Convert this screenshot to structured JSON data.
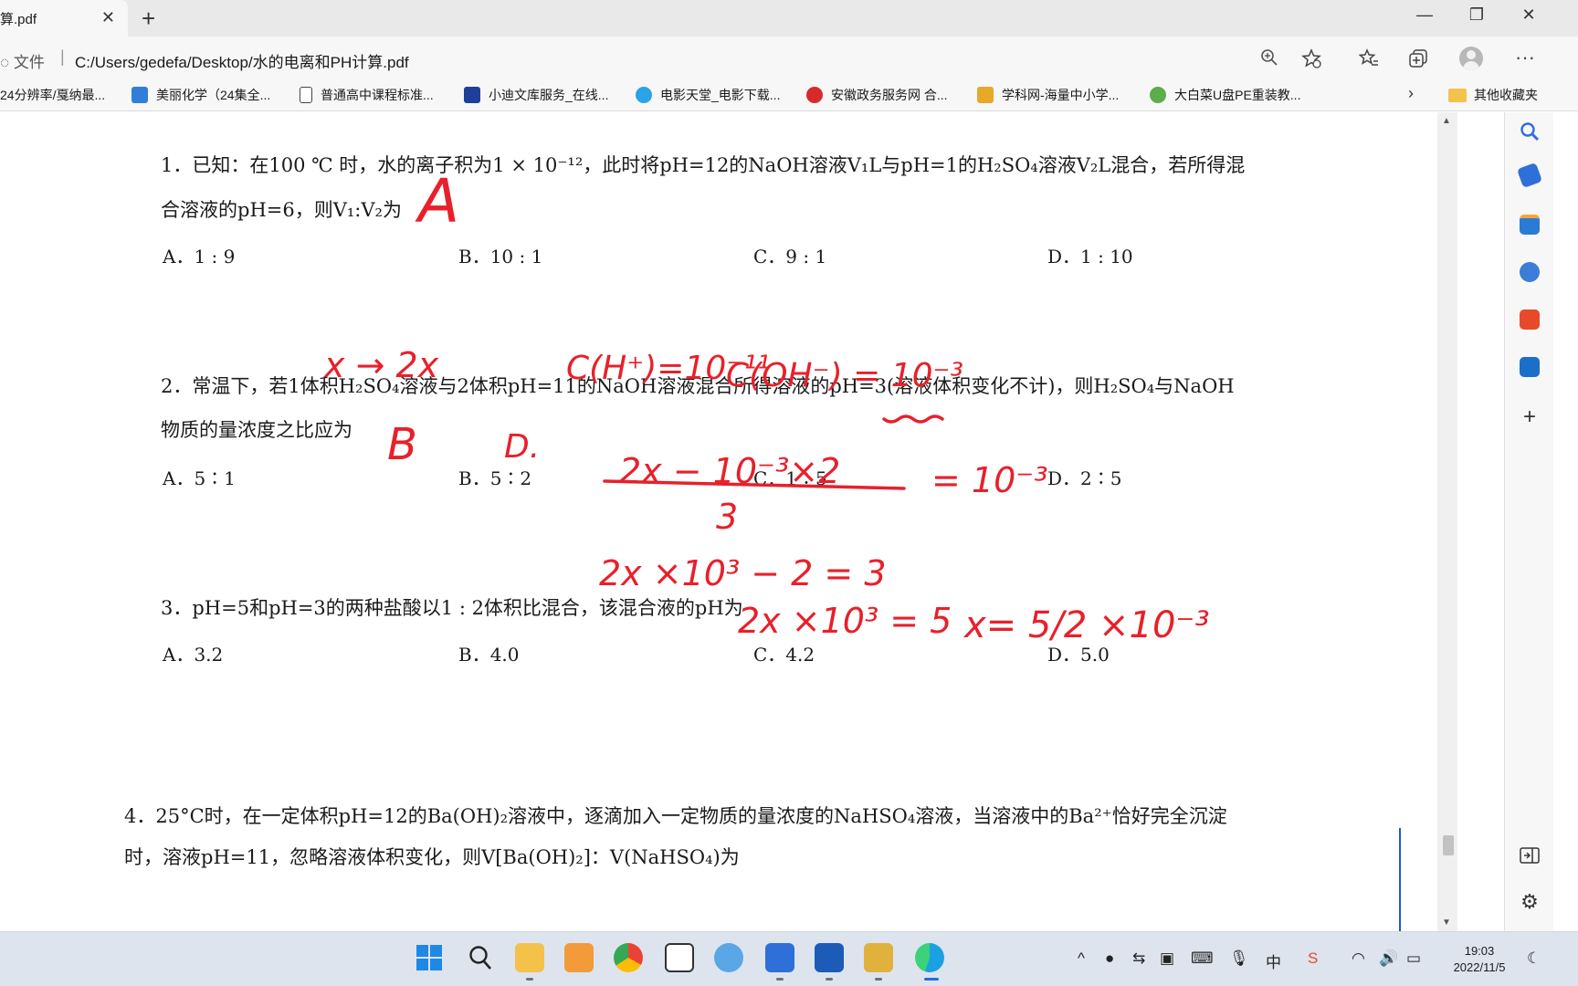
{
  "browser": {
    "tab_title": "算.pdf",
    "tab_close": "✕",
    "new_tab": "+",
    "window_controls": {
      "minimize": "—",
      "restore": "❐",
      "close": "✕"
    },
    "address_info_label": "文件",
    "address_url": "C:/Users/gedefa/Desktop/水的电离和PH计算.pdf",
    "toolbar_icons": [
      "zoom-icon",
      "add-favorite-icon",
      "favorites-icon",
      "collections-icon",
      "profile-avatar",
      "more-icon"
    ]
  },
  "favorites_bar": {
    "items": [
      {
        "label": "24分辨率/戛纳最...",
        "color": "#ffffff"
      },
      {
        "label": "美丽化学（24集全...",
        "color": "#2f7fd8"
      },
      {
        "label": "普通高中课程标准...",
        "color": "#ffffff"
      },
      {
        "label": "小迪文库服务_在线...",
        "color": "#1f3f9a"
      },
      {
        "label": "电影天堂_电影下载...",
        "color": "#2aa4e6"
      },
      {
        "label": "安徽政务服务网 合...",
        "color": "#d72b2b"
      },
      {
        "label": "学科网-海量中小学...",
        "color": "#e7a92a"
      },
      {
        "label": "大白菜U盘PE重装教...",
        "color": "#5cae4a"
      }
    ],
    "more": "›",
    "other_favorites": "其他收藏夹"
  },
  "document": {
    "q1": {
      "line1": "1．已知：在100 ℃ 时，水的离子积为1 × 10⁻¹²，此时将pH=12的NaOH溶液V₁L与pH=1的H₂SO₄溶液V₂L混合，若所得混",
      "line2": "合溶液的pH=6，则V₁:V₂为",
      "options": [
        "A．1 : 9",
        "B．10 : 1",
        "C．9 : 1",
        "D．1 : 10"
      ]
    },
    "q2": {
      "line1": "2．常温下，若1体积H₂SO₄溶液与2体积pH=11的NaOH溶液混合所得溶液的pH=3(溶液体积变化不计)，则H₂SO₄与NaOH",
      "line2": "物质的量浓度之比应为",
      "options": [
        "A．5∶1",
        "B．5∶2",
        "C．1∶5",
        "D．2∶5"
      ]
    },
    "q3": {
      "line1": "3．pH=5和pH=3的两种盐酸以1 : 2体积比混合，该混合液的pH为",
      "options": [
        "A．3.2",
        "B．4.0",
        "C．4.2",
        "D．5.0"
      ]
    },
    "q4": {
      "line1": "4．25°C时，在一定体积pH=12的Ba(OH)₂溶液中，逐滴加入一定物质的量浓度的NaHSO₄溶液，当溶液中的Ba²⁺恰好完全沉淀",
      "line2": "时，溶液pH=11，忽略溶液体积变化，则V[Ba(OH)₂]：V(NaHSO₄)为"
    },
    "annotations": {
      "q1_answer": "A",
      "q2_answer": "B",
      "q2_choice_mark": "D.",
      "x_to_2x": "x → 2x",
      "c_h": "C(H⁺)=10⁻¹¹",
      "c_oh": "C(OH⁻) = 10⁻³",
      "numerator": "2x − 10⁻³×2",
      "denominator": "3",
      "equals_rhs": "= 10⁻³",
      "step1": "2x ×10³ − 2 = 3",
      "step2": "2x ×10³ = 5",
      "result": "x= 5/2 ×10⁻³"
    }
  },
  "sidebar_icons": [
    "search-icon",
    "shopping-icon",
    "tools-icon",
    "games-icon",
    "office-icon",
    "outlook-icon",
    "add-icon",
    "split-screen-icon",
    "settings-icon"
  ],
  "taskbar": {
    "time": "19:03",
    "date": "2022/11/5",
    "ime": "中"
  }
}
